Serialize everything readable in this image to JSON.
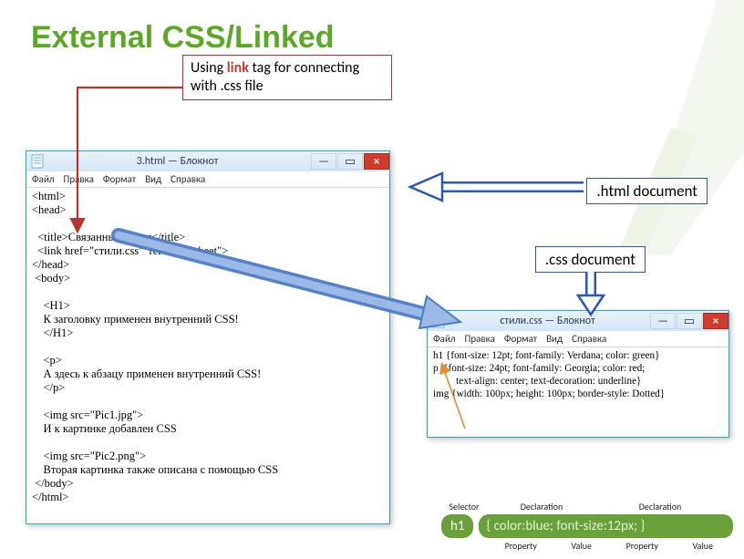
{
  "title": "External CSS/Linked",
  "callout": {
    "pre": "Using ",
    "em": "link",
    "post": " tag for connecting with .css file"
  },
  "labels": {
    "html": ".html document",
    "css": ".css document"
  },
  "notepad": {
    "menus": [
      "Файл",
      "Правка",
      "Формат",
      "Вид",
      "Справка"
    ],
    "btn_min": "—",
    "btn_max": "▭",
    "btn_close": "×"
  },
  "win_html": {
    "title": "3.html — Блокнот",
    "body": "<html>\n<head>\n\n  <title>Связанные стили</title>\n  <link href=\"стили.css\"  rel=\"stylesheet\">\n</head>\n <body>\n\n    <H1>\n    К заголовку применен внутренний CSS!\n    </H1>\n\n    <p>\n    А здесь к абзацу применен внутренний CSS!\n    </p>\n\n    <img src=\"Pic1.jpg\">\n    И к картинке добавлен CSS\n\n    <img src=\"Pic2.png\">\n    Вторая картинка также описана с помощью CSS\n </body>\n</html>"
  },
  "win_css": {
    "title": "стили.css — Блокнот",
    "body": "h1 {font-size: 12pt; font-family: Verdana; color: green}\np  {font-size: 24pt; font-family: Georgia; color: red;\n         text-align: center; text-decoration: underline}\nimg {width: 100px; height: 100px; border-style: Dotted}"
  },
  "rule": {
    "legend_top": [
      "Selector",
      "Declaration",
      "Declaration"
    ],
    "selector": "h1",
    "declaration": "{ color:blue; font-size:12px; }",
    "legend_bot": [
      "Property",
      "Value",
      "Property",
      "Value"
    ]
  },
  "decor": {
    "bg_leaf_color": "#cfe4bd"
  }
}
